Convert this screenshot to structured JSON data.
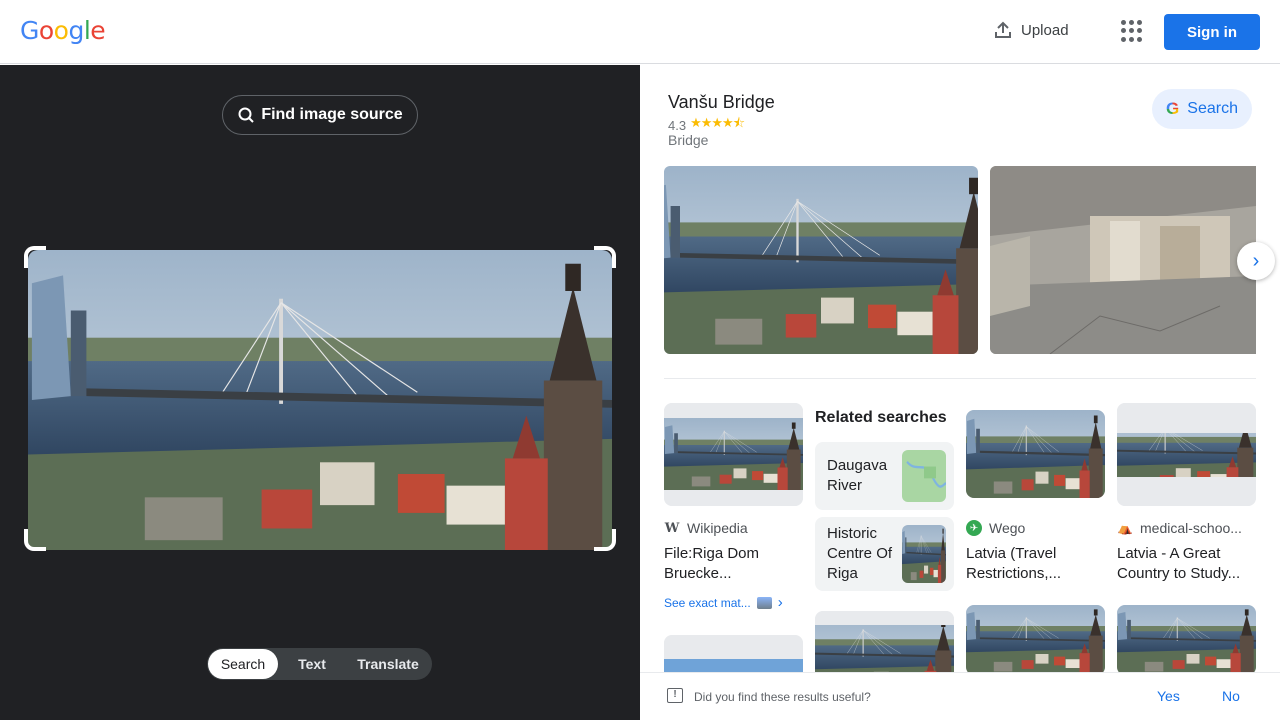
{
  "header": {
    "logo_letters": [
      "G",
      "o",
      "o",
      "g",
      "l",
      "e"
    ],
    "upload_label": "Upload",
    "signin_label": "Sign in"
  },
  "left": {
    "find_source_label": "Find image source",
    "modes": [
      {
        "label": "Search",
        "active": true
      },
      {
        "label": "Text",
        "active": false
      },
      {
        "label": "Translate",
        "active": false
      }
    ]
  },
  "entity": {
    "title": "Vanšu Bridge",
    "rating": "4.3",
    "stars": "★★★★⯪",
    "type": "Bridge",
    "search_label": "Search"
  },
  "related": {
    "heading": "Related searches",
    "items": [
      {
        "label": "Daugava River"
      },
      {
        "label": "Historic Centre Of Riga"
      }
    ]
  },
  "results": [
    {
      "source": "Wikipedia",
      "title": "File:Riga Dom Bruecke...",
      "exact_label": "See exact mat..."
    },
    {
      "source": "Wego",
      "title": "Latvia (Travel Restrictions,..."
    },
    {
      "source": "medical-schoo...",
      "title": "Latvia - A Great Country to Study..."
    }
  ],
  "feedback": {
    "question": "Did you find these results useful?",
    "yes": "Yes",
    "no": "No"
  },
  "colors": {
    "accent": "#1a73e8",
    "dark_pane": "#202124",
    "star": "#fbbc04"
  }
}
